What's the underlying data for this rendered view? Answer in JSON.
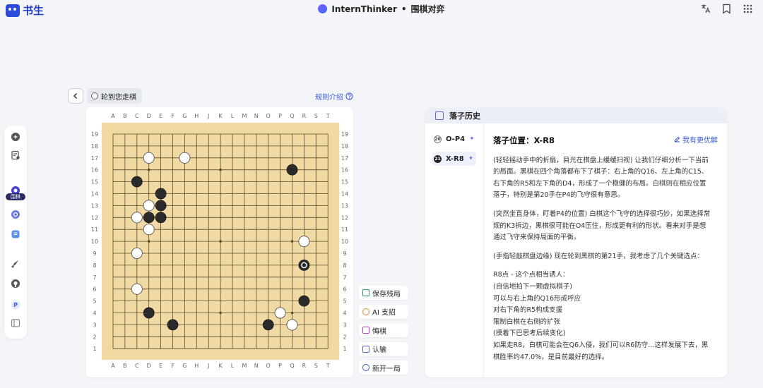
{
  "app": {
    "logo_text": "书生",
    "title": "InternThinker",
    "title_sep": "•",
    "subtitle": "围棋对弈"
  },
  "left_rail": {
    "badge": "围棋"
  },
  "board_header": {
    "turn_label": "轮到您走棋",
    "rules_label": "规则介绍"
  },
  "board": {
    "size": 19,
    "columns": [
      "A",
      "B",
      "C",
      "D",
      "E",
      "F",
      "G",
      "H",
      "J",
      "K",
      "L",
      "M",
      "N",
      "O",
      "P",
      "Q",
      "R",
      "S",
      "T"
    ],
    "rows": [
      "19",
      "18",
      "17",
      "16",
      "15",
      "14",
      "13",
      "12",
      "11",
      "10",
      "9",
      "8",
      "7",
      "6",
      "5",
      "4",
      "3",
      "2",
      "1"
    ],
    "black_stones": [
      "C15",
      "E14",
      "E13",
      "D12",
      "E12",
      "Q16",
      "R5",
      "D4",
      "F3",
      "O3",
      "R8"
    ],
    "white_stones": [
      "D17",
      "G17",
      "D13",
      "C12",
      "D11",
      "R10",
      "C9",
      "C6",
      "P4",
      "Q3"
    ],
    "last_move": "R8",
    "colors": {
      "board": "#f0d9a3",
      "line": "#5a4a2a",
      "black": "#2a2a2a",
      "white": "#ffffff"
    }
  },
  "actions": [
    {
      "label": "保存残局",
      "icon": "save-icon",
      "color": "#2e9a5a"
    },
    {
      "label": "AI 支招",
      "icon": "bulb-icon",
      "color": "#e08a2a"
    },
    {
      "label": "悔棋",
      "icon": "undo-icon",
      "color": "#b440c8"
    },
    {
      "label": "认输",
      "icon": "flag-icon",
      "color": "#5a68c8"
    },
    {
      "label": "新开一局",
      "icon": "plus-icon",
      "color": "#3a5bd9"
    }
  ],
  "history": {
    "title": "落子历史",
    "moves": [
      {
        "num": "20",
        "label": "O-P4",
        "color": "white"
      },
      {
        "num": "21",
        "label": "X-R8",
        "color": "black"
      }
    ],
    "detail_title": "落子位置：X-R8",
    "better_label": "我有更优解",
    "paragraphs": [
      [
        "(轻轻摇动手中的折扇，目光在棋盘上缓缓扫视) 让我们仔细分析一下当前",
        "的局面。黑棋在四个角落都布下了棋子：右上角的Q16、左上角的C15、",
        "右下角的R5和左下角的D4，形成了一个稳健的布局。白棋则在相应位置",
        "落子，特别是第20手在P4的飞守很有意思。"
      ],
      [
        "(突然坐直身体，盯着P4的位置) 白棋这个飞守的选择很巧妙，如果选择常",
        "规的K3拆边，黑棋很可能在O4压住，形成更有利的形状。看来对手是想",
        "通过飞守来保持局面的平衡。"
      ],
      [
        "(手指轻敲棋盘边缘) 现在轮到黑棋的第21手，我考虑了几个关键选点："
      ],
      [
        "R8点 - 这个点相当诱人：",
        "(自信地拍下一颗虚拟棋子)",
        "可以与右上角的Q16形成呼应",
        "对右下角的R5构成支援",
        "限制白棋在右侧的扩张",
        "(摸着下巴思考后续变化)",
        "如果走R8，白棋可能会在Q6入侵，我们可以R6防守...这样发展下去，黑",
        "棋胜率约47.0%，是目前最好的选择。"
      ]
    ]
  }
}
